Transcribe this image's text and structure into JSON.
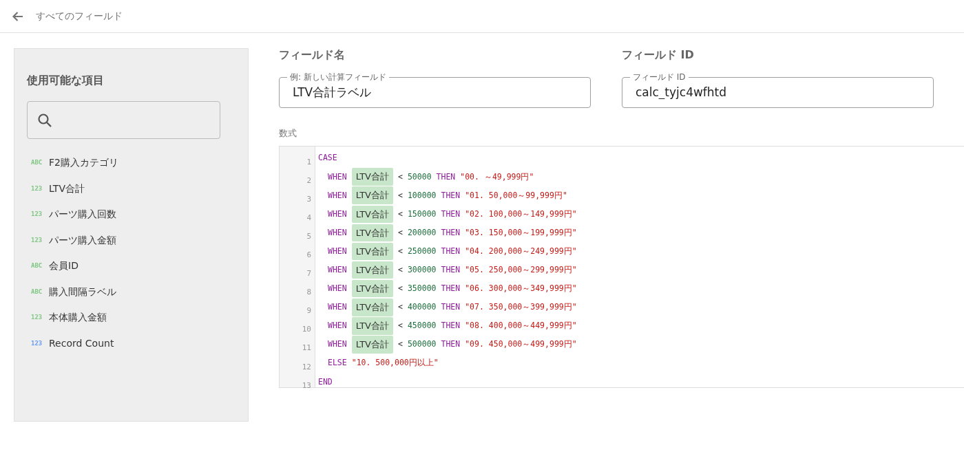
{
  "header": {
    "back_label": "すべてのフィールド"
  },
  "sidebar": {
    "title": "使用可能な項目",
    "items": [
      {
        "type": "ABC",
        "color": "#81c784",
        "label": "F2購入カテゴリ"
      },
      {
        "type": "123",
        "color": "#81c784",
        "label": "LTV合計"
      },
      {
        "type": "123",
        "color": "#81c784",
        "label": "パーツ購入回数"
      },
      {
        "type": "123",
        "color": "#81c784",
        "label": "パーツ購入金額"
      },
      {
        "type": "ABC",
        "color": "#81c784",
        "label": "会員ID"
      },
      {
        "type": "ABC",
        "color": "#81c784",
        "label": "購入間隔ラベル"
      },
      {
        "type": "123",
        "color": "#81c784",
        "label": "本体購入金額"
      },
      {
        "type": "123",
        "color": "#669df6",
        "label": "Record Count"
      }
    ]
  },
  "field_name": {
    "heading": "フィールド名",
    "placeholder": "例: 新しい計算フィールド",
    "value": "LTV合計ラベル"
  },
  "field_id": {
    "heading": "フィールド ID",
    "label": "フィールド ID",
    "value": "calc_tyjc4wfhtd"
  },
  "formula": {
    "label": "数式",
    "lines": [
      {
        "number": "1",
        "indented": false,
        "tokens": [
          {
            "kind": "keyword",
            "text": "CASE"
          }
        ]
      },
      {
        "number": "2",
        "indented": true,
        "tokens": [
          {
            "kind": "keyword",
            "text": "WHEN"
          },
          {
            "kind": "field",
            "text": "LTV合計"
          },
          {
            "kind": "op",
            "text": "<"
          },
          {
            "kind": "number",
            "text": "50000"
          },
          {
            "kind": "keyword",
            "text": "THEN"
          },
          {
            "kind": "string",
            "text": "\"00. ～49,999円\""
          }
        ]
      },
      {
        "number": "3",
        "indented": true,
        "tokens": [
          {
            "kind": "keyword",
            "text": "WHEN"
          },
          {
            "kind": "field",
            "text": "LTV合計"
          },
          {
            "kind": "op",
            "text": "<"
          },
          {
            "kind": "number",
            "text": "100000"
          },
          {
            "kind": "keyword",
            "text": "THEN"
          },
          {
            "kind": "string",
            "text": "\"01. 50,000～99,999円\""
          }
        ]
      },
      {
        "number": "4",
        "indented": true,
        "tokens": [
          {
            "kind": "keyword",
            "text": "WHEN"
          },
          {
            "kind": "field",
            "text": "LTV合計"
          },
          {
            "kind": "op",
            "text": "<"
          },
          {
            "kind": "number",
            "text": "150000"
          },
          {
            "kind": "keyword",
            "text": "THEN"
          },
          {
            "kind": "string",
            "text": "\"02. 100,000～149,999円\""
          }
        ]
      },
      {
        "number": "5",
        "indented": true,
        "tokens": [
          {
            "kind": "keyword",
            "text": "WHEN"
          },
          {
            "kind": "field",
            "text": "LTV合計"
          },
          {
            "kind": "op",
            "text": "<"
          },
          {
            "kind": "number",
            "text": "200000"
          },
          {
            "kind": "keyword",
            "text": "THEN"
          },
          {
            "kind": "string",
            "text": "\"03. 150,000～199,999円\""
          }
        ]
      },
      {
        "number": "6",
        "indented": true,
        "tokens": [
          {
            "kind": "keyword",
            "text": "WHEN"
          },
          {
            "kind": "field",
            "text": "LTV合計"
          },
          {
            "kind": "op",
            "text": "<"
          },
          {
            "kind": "number",
            "text": "250000"
          },
          {
            "kind": "keyword",
            "text": "THEN"
          },
          {
            "kind": "string",
            "text": "\"04. 200,000～249,999円\""
          }
        ]
      },
      {
        "number": "7",
        "indented": true,
        "tokens": [
          {
            "kind": "keyword",
            "text": "WHEN"
          },
          {
            "kind": "field",
            "text": "LTV合計"
          },
          {
            "kind": "op",
            "text": "<"
          },
          {
            "kind": "number",
            "text": "300000"
          },
          {
            "kind": "keyword",
            "text": "THEN"
          },
          {
            "kind": "string",
            "text": "\"05. 250,000～299,999円\""
          }
        ]
      },
      {
        "number": "8",
        "indented": true,
        "tokens": [
          {
            "kind": "keyword",
            "text": "WHEN"
          },
          {
            "kind": "field",
            "text": "LTV合計"
          },
          {
            "kind": "op",
            "text": "<"
          },
          {
            "kind": "number",
            "text": "350000"
          },
          {
            "kind": "keyword",
            "text": "THEN"
          },
          {
            "kind": "string",
            "text": "\"06. 300,000～349,999円\""
          }
        ]
      },
      {
        "number": "9",
        "indented": true,
        "tokens": [
          {
            "kind": "keyword",
            "text": "WHEN"
          },
          {
            "kind": "field",
            "text": "LTV合計"
          },
          {
            "kind": "op",
            "text": "<"
          },
          {
            "kind": "number",
            "text": "400000"
          },
          {
            "kind": "keyword",
            "text": "THEN"
          },
          {
            "kind": "string",
            "text": "\"07. 350,000～399,999円\""
          }
        ]
      },
      {
        "number": "10",
        "indented": true,
        "tokens": [
          {
            "kind": "keyword",
            "text": "WHEN"
          },
          {
            "kind": "field",
            "text": "LTV合計"
          },
          {
            "kind": "op",
            "text": "<"
          },
          {
            "kind": "number",
            "text": "450000"
          },
          {
            "kind": "keyword",
            "text": "THEN"
          },
          {
            "kind": "string",
            "text": "\"08. 400,000～449,999円\""
          }
        ]
      },
      {
        "number": "11",
        "indented": true,
        "tokens": [
          {
            "kind": "keyword",
            "text": "WHEN"
          },
          {
            "kind": "field",
            "text": "LTV合計"
          },
          {
            "kind": "op",
            "text": "<"
          },
          {
            "kind": "number",
            "text": "500000"
          },
          {
            "kind": "keyword",
            "text": "THEN"
          },
          {
            "kind": "string",
            "text": "\"09. 450,000～499,999円\""
          }
        ]
      },
      {
        "number": "12",
        "indented": true,
        "tokens": [
          {
            "kind": "keyword",
            "text": "ELSE"
          },
          {
            "kind": "string",
            "text": "\"10. 500,000円以上\""
          }
        ]
      },
      {
        "number": "13",
        "indented": false,
        "tokens": [
          {
            "kind": "keyword",
            "text": "END"
          }
        ]
      }
    ]
  }
}
